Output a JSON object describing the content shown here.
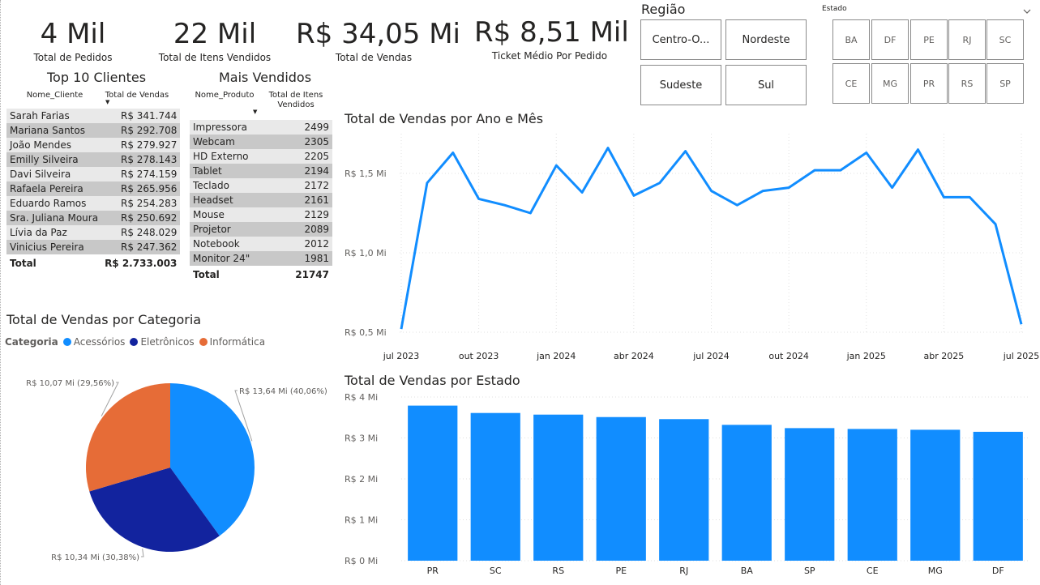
{
  "kpis": [
    {
      "value": "4 Mil",
      "label": "Total de Pedidos"
    },
    {
      "value": "22 Mil",
      "label": "Total de Itens Vendidos"
    },
    {
      "value": "R$ 34,05 Mi",
      "label": "Total de Vendas"
    },
    {
      "value": "R$ 8,51 Mil",
      "label": "Ticket Médio Por Pedido"
    }
  ],
  "regiao": {
    "title": "Região",
    "options": [
      "Centro-O...",
      "Nordeste",
      "Sudeste",
      "Sul"
    ]
  },
  "estado": {
    "title": "Estado",
    "options": [
      "BA",
      "DF",
      "PE",
      "RJ",
      "SC",
      "CE",
      "MG",
      "PR",
      "RS",
      "SP"
    ]
  },
  "top_clientes": {
    "title": "Top 10 Clientes",
    "col_name": "Nome_Cliente",
    "col_value": "Total de Vendas",
    "rows": [
      {
        "name": "Sarah Farias",
        "value": "R$ 341.744"
      },
      {
        "name": "Mariana Santos",
        "value": "R$ 292.708"
      },
      {
        "name": "João Mendes",
        "value": "R$ 279.927"
      },
      {
        "name": "Emilly Silveira",
        "value": "R$ 278.143"
      },
      {
        "name": "Davi Silveira",
        "value": "R$ 274.159"
      },
      {
        "name": "Rafaela Pereira",
        "value": "R$ 265.956"
      },
      {
        "name": "Eduardo Ramos",
        "value": "R$ 254.283"
      },
      {
        "name": "Sra. Juliana Moura",
        "value": "R$ 250.692"
      },
      {
        "name": "Lívia da Paz",
        "value": "R$ 248.029"
      },
      {
        "name": "Vinicius Pereira",
        "value": "R$ 247.362"
      }
    ],
    "total_label": "Total",
    "total_value": "R$ 2.733.003"
  },
  "mais_vendidos": {
    "title": "Mais Vendidos",
    "col_name": "Nome_Produto",
    "col_value_line1": "Total de Itens",
    "col_value_line2": "Vendidos",
    "rows": [
      {
        "name": "Impressora",
        "value": "2499"
      },
      {
        "name": "Webcam",
        "value": "2305"
      },
      {
        "name": "HD Externo",
        "value": "2205"
      },
      {
        "name": "Tablet",
        "value": "2194"
      },
      {
        "name": "Teclado",
        "value": "2172"
      },
      {
        "name": "Headset",
        "value": "2161"
      },
      {
        "name": "Mouse",
        "value": "2129"
      },
      {
        "name": "Projetor",
        "value": "2089"
      },
      {
        "name": "Notebook",
        "value": "2012"
      },
      {
        "name": "Monitor 24\"",
        "value": "1981"
      }
    ],
    "total_label": "Total",
    "total_value": "21747"
  },
  "colors": {
    "accent": "#118dff",
    "acessorios": "#118dff",
    "eletronicos": "#12239e",
    "informatica": "#e66c37"
  },
  "chart_data": [
    {
      "type": "line",
      "title": "Total de Vendas por Ano e Mês",
      "x_ticks": [
        "jul 2023",
        "out 2023",
        "jan 2024",
        "abr 2024",
        "jul 2024",
        "out 2024",
        "jan 2025",
        "abr 2025",
        "jul 2025"
      ],
      "y_ticks": [
        "R$ 0,5 Mi",
        "R$ 1,0 Mi",
        "R$ 1,5 Mi"
      ],
      "ylim": [
        0.5,
        1.75
      ],
      "x": [
        "2023-07",
        "2023-08",
        "2023-09",
        "2023-10",
        "2023-11",
        "2023-12",
        "2024-01",
        "2024-02",
        "2024-03",
        "2024-04",
        "2024-05",
        "2024-06",
        "2024-07",
        "2024-08",
        "2024-09",
        "2024-10",
        "2024-11",
        "2024-12",
        "2025-01",
        "2025-02",
        "2025-03",
        "2025-04",
        "2025-05",
        "2025-06",
        "2025-07"
      ],
      "values": [
        0.52,
        1.44,
        1.63,
        1.34,
        1.3,
        1.25,
        1.55,
        1.38,
        1.66,
        1.36,
        1.44,
        1.64,
        1.39,
        1.3,
        1.39,
        1.41,
        1.52,
        1.52,
        1.63,
        1.41,
        1.65,
        1.35,
        1.35,
        1.18,
        0.55
      ],
      "grid": true
    },
    {
      "type": "bar",
      "title": "Total de Vendas por Estado",
      "categories": [
        "PR",
        "SC",
        "RS",
        "PE",
        "RJ",
        "BA",
        "SP",
        "CE",
        "MG",
        "DF"
      ],
      "values": [
        3.79,
        3.61,
        3.57,
        3.51,
        3.46,
        3.32,
        3.24,
        3.22,
        3.2,
        3.15
      ],
      "y_ticks": [
        "R$ 0 Mi",
        "R$ 1 Mi",
        "R$ 2 Mi",
        "R$ 3 Mi",
        "R$ 4 Mi"
      ],
      "ylim": [
        0,
        4
      ],
      "grid": true
    },
    {
      "type": "pie",
      "title": "Total de Vendas por Categoria",
      "legend_title": "Categoria",
      "categories": [
        "Acessórios",
        "Eletrônicos",
        "Informática"
      ],
      "values": [
        13.64,
        10.34,
        10.07
      ],
      "labels": [
        "R$ 13,64 Mi (40,06%)",
        "R$ 10,34 Mi (30,38%)",
        "R$ 10,07 Mi (29,56%)"
      ],
      "legend_placement": "top-left"
    }
  ]
}
